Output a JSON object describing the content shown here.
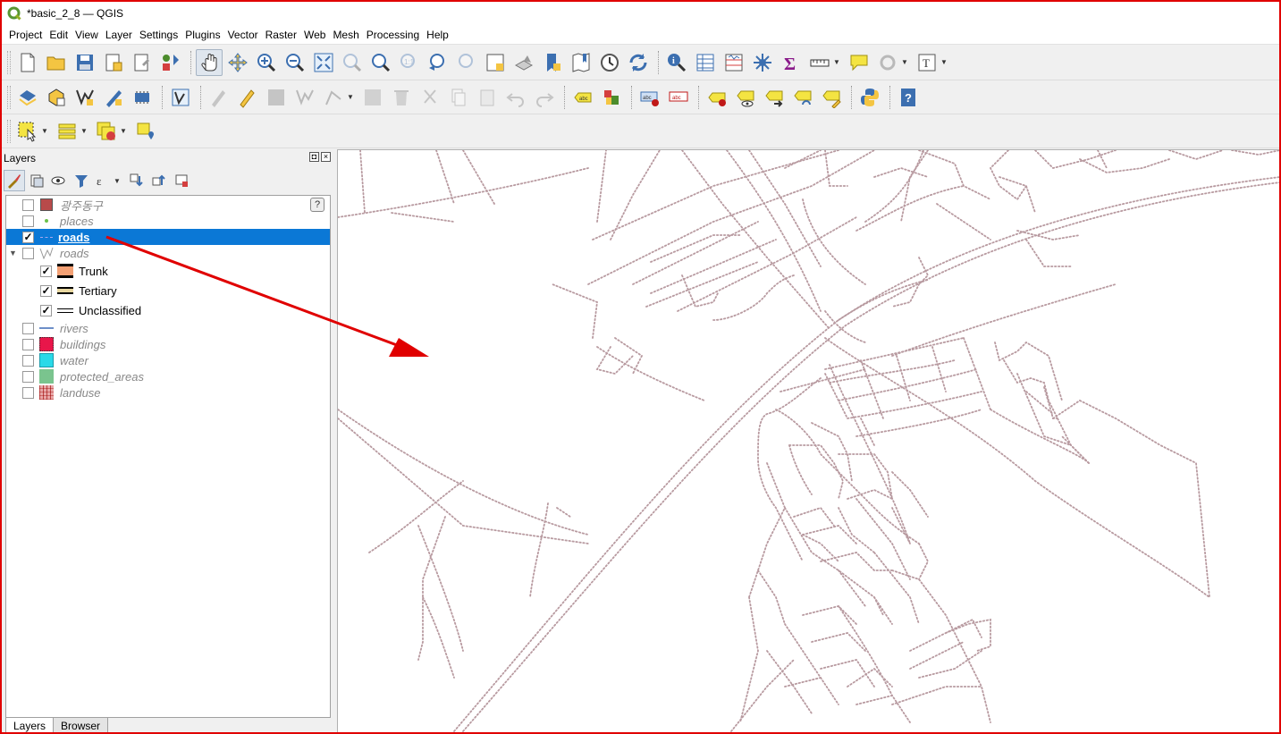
{
  "window": {
    "title": "*basic_2_8 — QGIS"
  },
  "menubar": [
    "Project",
    "Edit",
    "View",
    "Layer",
    "Settings",
    "Plugins",
    "Vector",
    "Raster",
    "Web",
    "Mesh",
    "Processing",
    "Help"
  ],
  "toolbars": {
    "file": [
      "new-project-icon",
      "open-project-icon",
      "save-project-icon",
      "new-print-layout-icon",
      "layout-manager-icon",
      "style-manager-icon"
    ],
    "navigation": [
      "pan-icon",
      "pan-to-selection-icon",
      "zoom-in-icon",
      "zoom-out-icon",
      "zoom-full-icon",
      "zoom-to-selection-icon",
      "zoom-to-layer-icon",
      "zoom-native-icon",
      "zoom-last-icon",
      "zoom-next-icon",
      "new-map-view-icon",
      "new-3d-map-icon",
      "new-bookmark-icon",
      "show-bookmarks-icon",
      "temporal-controller-icon",
      "refresh-icon"
    ],
    "attributes": [
      "identify-icon",
      "attribute-table-icon",
      "field-calculator-icon",
      "statistics-icon",
      "sum-icon",
      "measure-icon",
      "map-tips-icon",
      "search-icon",
      "text-annotation-icon"
    ]
  },
  "layers_panel": {
    "title": "Layers",
    "tabs": [
      "Layers",
      "Browser"
    ],
    "active_tab": "Layers",
    "layers": [
      {
        "name": "광주동구",
        "checked": false,
        "symbol": "polygon",
        "color": "#b84a4a",
        "help": "?"
      },
      {
        "name": "places",
        "checked": false,
        "symbol": "point",
        "color": "#6cc24a"
      },
      {
        "name": "roads",
        "checked": true,
        "symbol": "line",
        "color": "#a7a7ee",
        "selected": true
      },
      {
        "name": "roads",
        "checked": false,
        "symbol": "categorized",
        "expanded": true,
        "categories": [
          {
            "label": "Trunk",
            "checked": true,
            "color": "#f3a074"
          },
          {
            "label": "Tertiary",
            "checked": true,
            "color": "#e8d7a0"
          },
          {
            "label": "Unclassified",
            "checked": true,
            "color": "#ffffff"
          }
        ]
      },
      {
        "name": "rivers",
        "checked": false,
        "symbol": "line",
        "color": "#6d8fc8"
      },
      {
        "name": "buildings",
        "checked": false,
        "symbol": "polygon",
        "color": "#e8164a"
      },
      {
        "name": "water",
        "checked": false,
        "symbol": "polygon",
        "color": "#29d9e8"
      },
      {
        "name": "protected_areas",
        "checked": false,
        "symbol": "polygon",
        "color": "#7ac48e"
      },
      {
        "name": "landuse",
        "checked": false,
        "symbol": "polygon",
        "color": "#cf6565"
      }
    ]
  },
  "map": {
    "road_color": "#b89aa0",
    "background": "#ffffff"
  },
  "annotation": {
    "arrow_color": "#e00000"
  }
}
